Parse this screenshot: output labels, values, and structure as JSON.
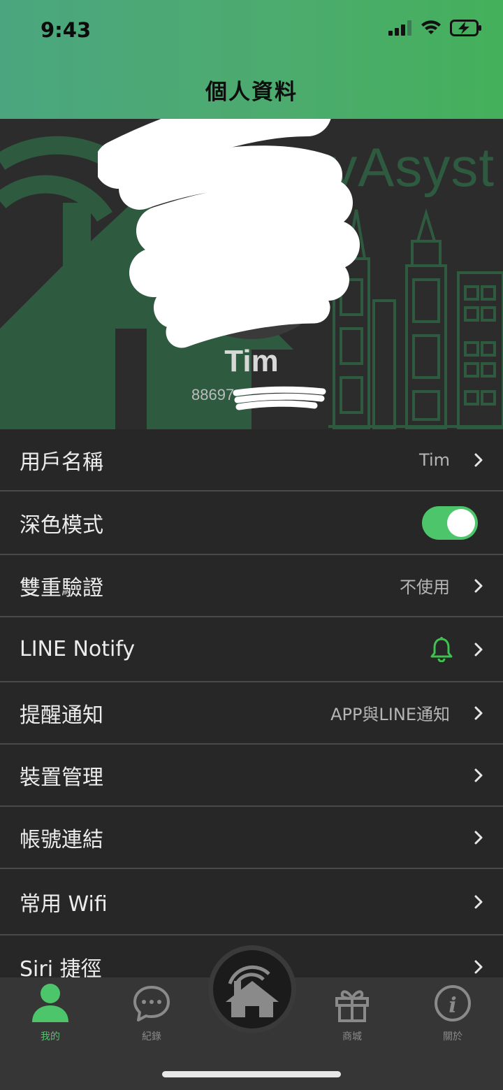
{
  "status_bar": {
    "time": "9:43"
  },
  "header": {
    "title": "個人資料"
  },
  "banner": {
    "brand_text": "yAsyst"
  },
  "profile": {
    "name": "Tim",
    "phone_prefix": "88697"
  },
  "settings": [
    {
      "label": "用戶名稱",
      "value": "Tim"
    },
    {
      "label": "深色模式",
      "toggle_on": true
    },
    {
      "label": "雙重驗證",
      "value": "不使用"
    },
    {
      "label": "LINE Notify",
      "icon": "bell-icon"
    },
    {
      "label": "提醒通知",
      "value": "APP與LINE通知"
    },
    {
      "label": "裝置管理"
    },
    {
      "label": "帳號連結"
    },
    {
      "label": "常用 Wifi"
    },
    {
      "label": "Siri 捷徑"
    }
  ],
  "tabbar": {
    "tabs": [
      {
        "label": "我的",
        "icon": "person-icon",
        "active": true
      },
      {
        "label": "紀錄",
        "icon": "chat-bubble-icon"
      },
      {
        "label": "",
        "icon": "home-wifi-icon"
      },
      {
        "label": "商城",
        "icon": "gift-icon"
      },
      {
        "label": "關於",
        "icon": "info-icon"
      }
    ]
  },
  "colors": {
    "accent": "#4cc56b",
    "header_start": "#4ba67f",
    "header_end": "#44b05b",
    "background": "#272727"
  }
}
